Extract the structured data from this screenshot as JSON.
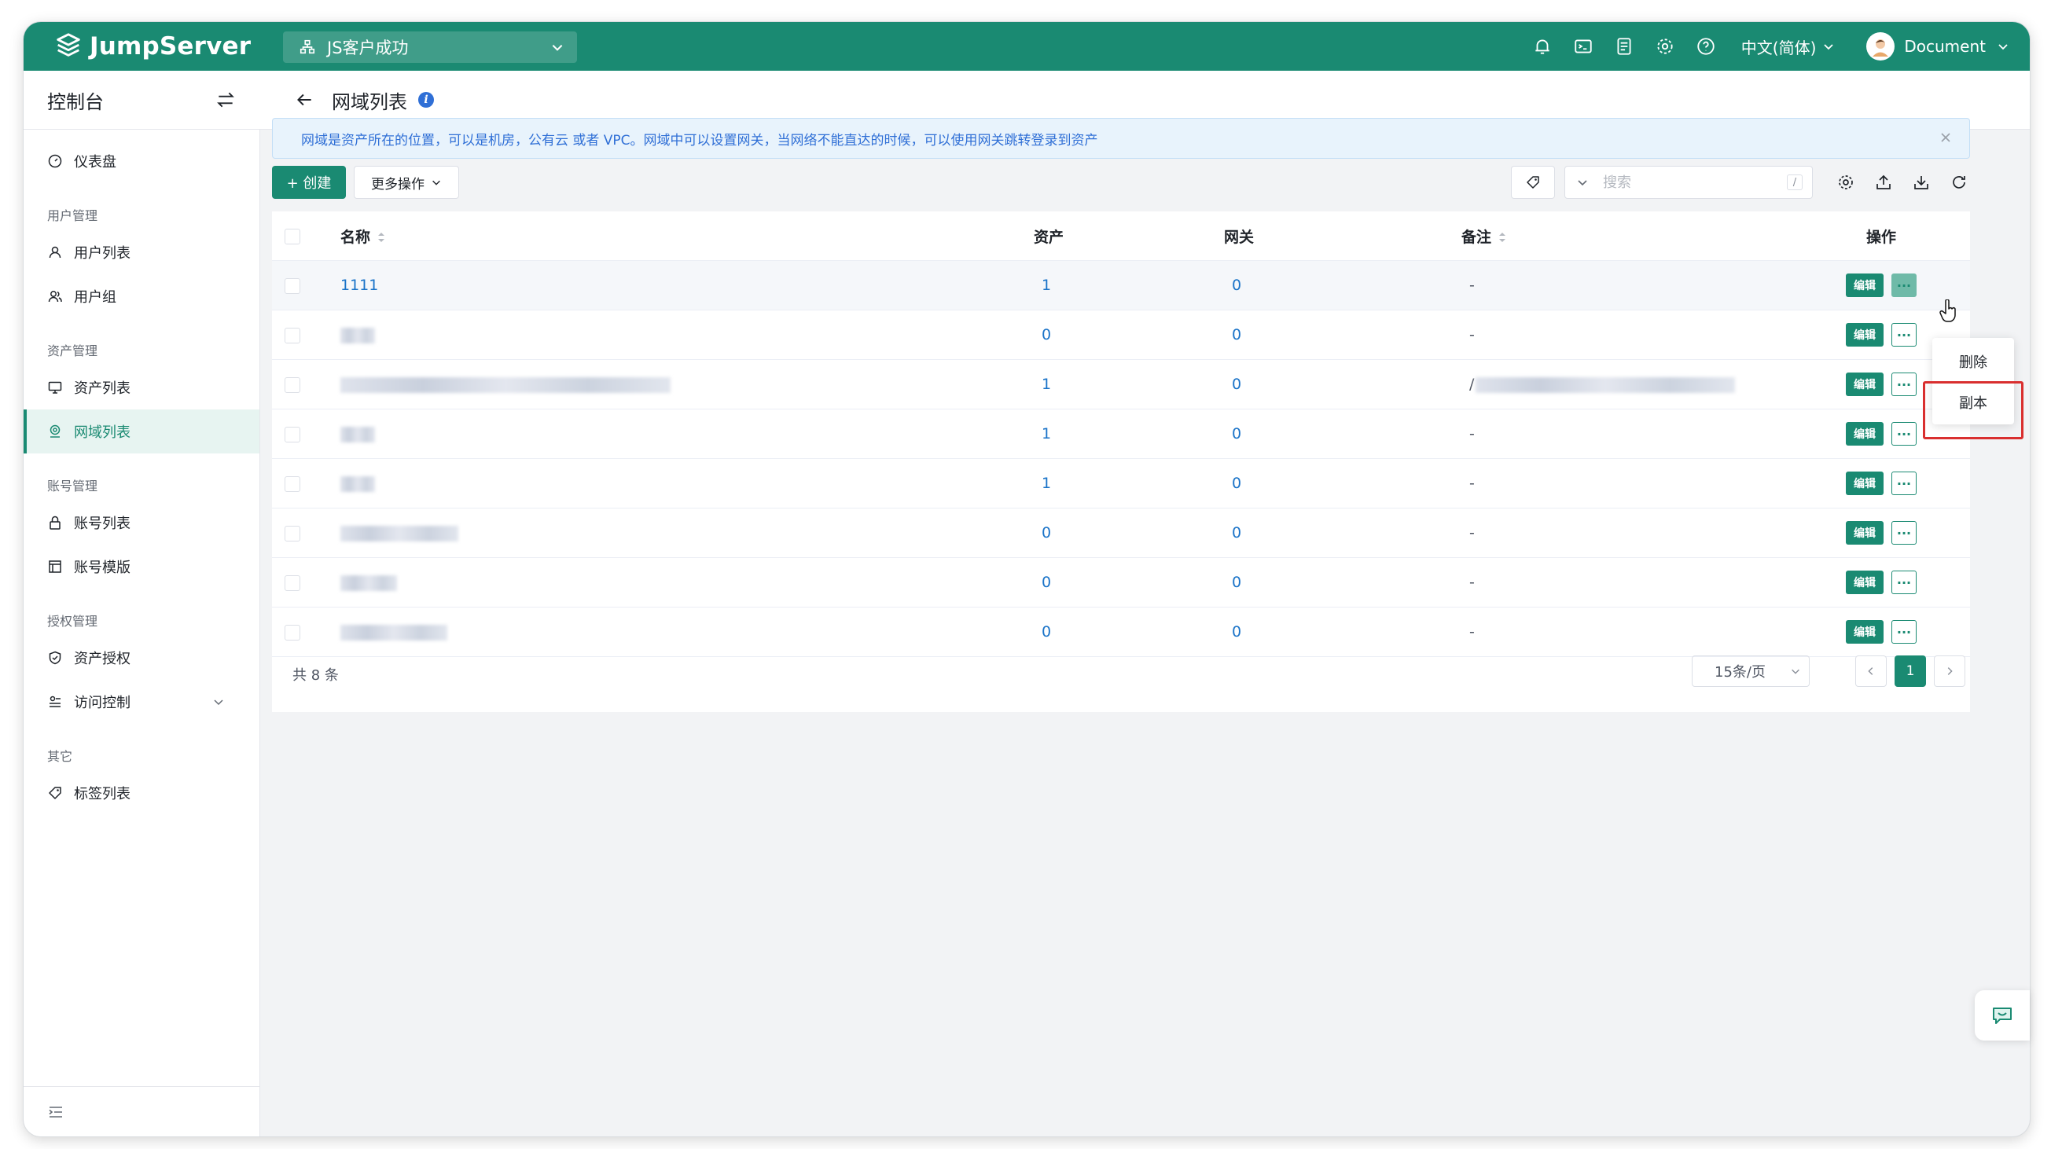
{
  "app": {
    "brand": "JumpServer",
    "org": "JS客户成功",
    "lang": "中文(简体)",
    "user": "Document",
    "accent": "#1a8a72"
  },
  "sidebar": {
    "title": "控制台",
    "groups": [
      {
        "label": "",
        "items": [
          {
            "label": "仪表盘",
            "icon": "dashboard-icon"
          }
        ]
      },
      {
        "label": "用户管理",
        "items": [
          {
            "label": "用户列表",
            "icon": "user-icon"
          },
          {
            "label": "用户组",
            "icon": "user-group-icon"
          }
        ]
      },
      {
        "label": "资产管理",
        "items": [
          {
            "label": "资产列表",
            "icon": "monitor-icon"
          },
          {
            "label": "网域列表",
            "icon": "location-icon",
            "active": true
          }
        ]
      },
      {
        "label": "账号管理",
        "items": [
          {
            "label": "账号列表",
            "icon": "lock-icon"
          },
          {
            "label": "账号模版",
            "icon": "template-icon"
          }
        ]
      },
      {
        "label": "授权管理",
        "items": [
          {
            "label": "资产授权",
            "icon": "shield-icon"
          },
          {
            "label": "访问控制",
            "icon": "access-control-icon",
            "expandable": true
          }
        ]
      },
      {
        "label": "其它",
        "items": [
          {
            "label": "标签列表",
            "icon": "tag-icon"
          }
        ]
      }
    ]
  },
  "page": {
    "title": "网域列表",
    "alert": "网域是资产所在的位置，可以是机房，公有云 或者 VPC。网域中可以设置网关，当网络不能直达的时候，可以使用网关跳转登录到资产"
  },
  "toolbar": {
    "create_label": "+ 创建",
    "more_label": "更多操作",
    "search_placeholder": "搜索",
    "search_shortcut": "/"
  },
  "table": {
    "headers": {
      "name": "名称",
      "assets": "资产",
      "gateways": "网关",
      "comment": "备注",
      "actions": "操作"
    },
    "rows": [
      {
        "name": "1111",
        "assets": "1",
        "gateways": "0",
        "comment": "-",
        "hover": true
      },
      {
        "name": "",
        "assets": "0",
        "gateways": "0",
        "comment": "-"
      },
      {
        "name": "",
        "assets": "1",
        "gateways": "0",
        "comment": "/"
      },
      {
        "name": "",
        "assets": "1",
        "gateways": "0",
        "comment": "-"
      },
      {
        "name": "",
        "assets": "1",
        "gateways": "0",
        "comment": "-"
      },
      {
        "name": "",
        "assets": "0",
        "gateways": "0",
        "comment": "-"
      },
      {
        "name": "",
        "assets": "0",
        "gateways": "0",
        "comment": "-"
      },
      {
        "name": "",
        "assets": "0",
        "gateways": "0",
        "comment": "-"
      }
    ],
    "edit_label": "编辑",
    "more_label": "···"
  },
  "pagination": {
    "total": "共 8 条",
    "page_size": "15条/页",
    "current_page": "1"
  },
  "dropdown": {
    "items": [
      "删除",
      "副本"
    ]
  }
}
